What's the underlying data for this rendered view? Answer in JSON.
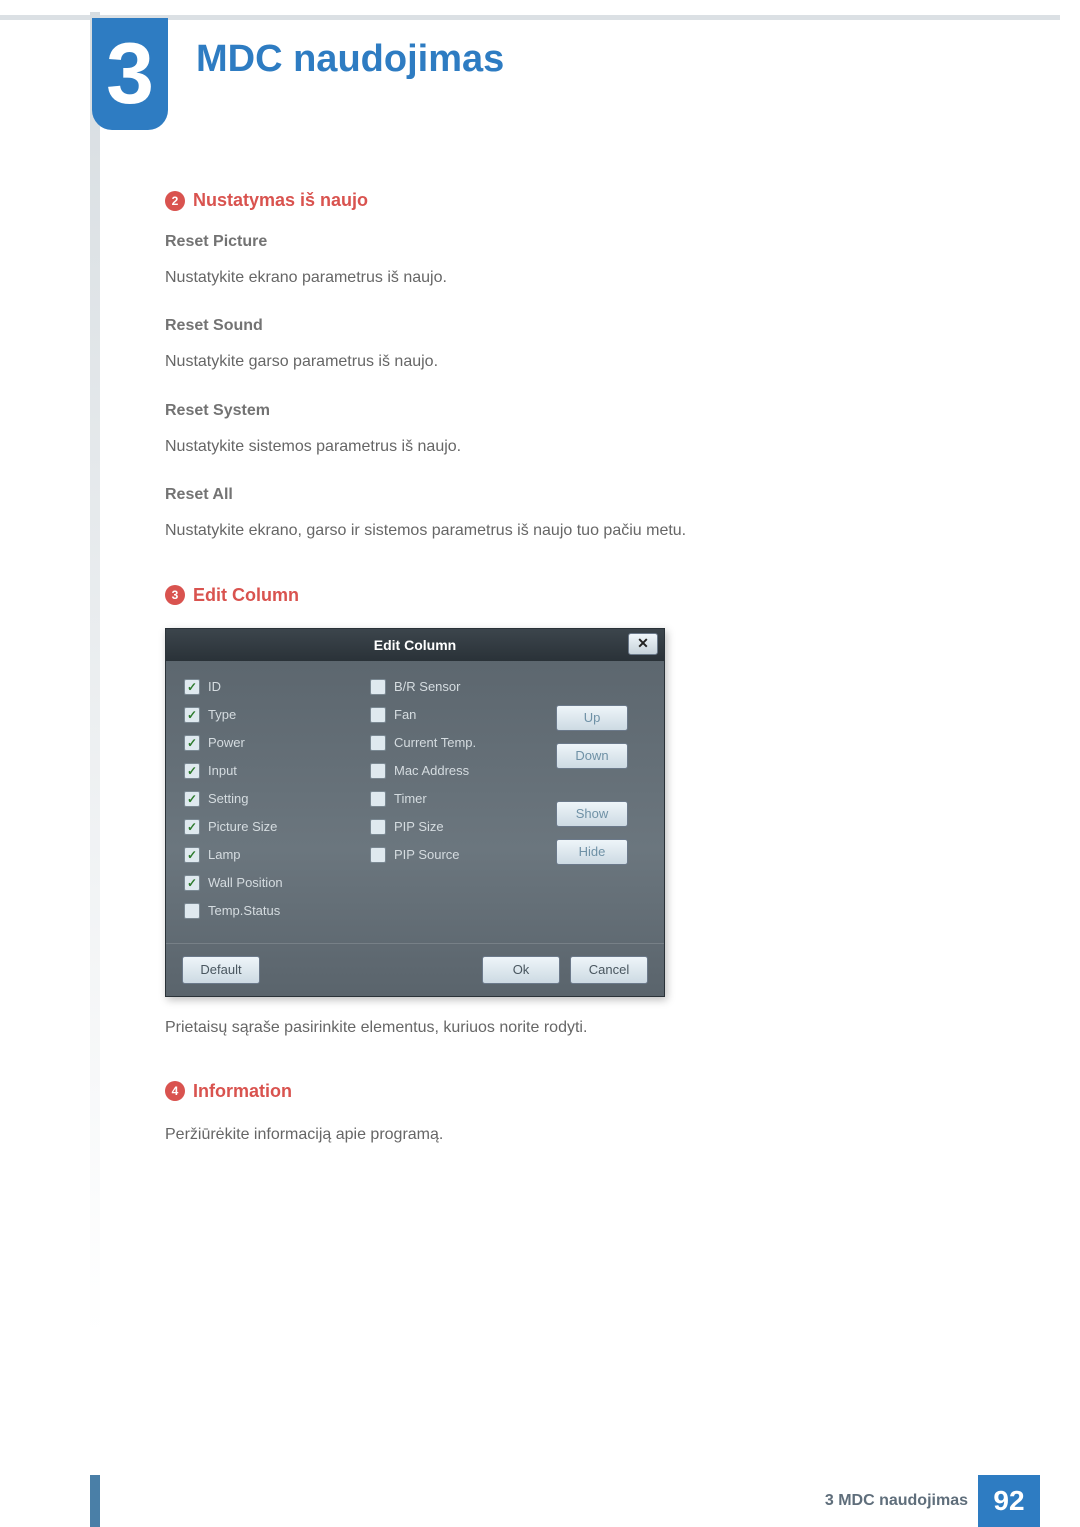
{
  "chapter": {
    "number": "3",
    "title": "MDC naudojimas"
  },
  "sections": {
    "reset": {
      "num": "2",
      "title": "Nustatymas iš naujo",
      "items": {
        "resetPicture": {
          "heading": "Reset Picture",
          "text": "Nustatykite ekrano parametrus iš naujo."
        },
        "resetSound": {
          "heading": "Reset Sound",
          "text": "Nustatykite garso parametrus iš naujo."
        },
        "resetSystem": {
          "heading": "Reset System",
          "text": "Nustatykite sistemos parametrus iš naujo."
        },
        "resetAll": {
          "heading": "Reset All",
          "text": "Nustatykite ekrano, garso ir sistemos parametrus iš naujo tuo pačiu metu."
        }
      }
    },
    "editColumn": {
      "num": "3",
      "title": "Edit Column",
      "caption": "Prietaisų sąraše pasirinkite elementus, kuriuos norite rodyti."
    },
    "information": {
      "num": "4",
      "title": "Information",
      "text": "Peržiūrėkite informaciją apie programą."
    }
  },
  "dialog": {
    "title": "Edit Column",
    "close": "✕",
    "columnsA": [
      {
        "label": "ID",
        "checked": true
      },
      {
        "label": "Type",
        "checked": true
      },
      {
        "label": "Power",
        "checked": true
      },
      {
        "label": "Input",
        "checked": true
      },
      {
        "label": "Setting",
        "checked": true
      },
      {
        "label": "Picture Size",
        "checked": true
      },
      {
        "label": "Lamp",
        "checked": true
      },
      {
        "label": "Wall Position",
        "checked": true
      },
      {
        "label": "Temp.Status",
        "checked": false
      }
    ],
    "columnsB": [
      {
        "label": "B/R Sensor",
        "checked": false
      },
      {
        "label": "Fan",
        "checked": false
      },
      {
        "label": "Current Temp.",
        "checked": false
      },
      {
        "label": "Mac Address",
        "checked": false
      },
      {
        "label": "Timer",
        "checked": false
      },
      {
        "label": "PIP Size",
        "checked": false
      },
      {
        "label": "PIP Source",
        "checked": false
      }
    ],
    "sideButtons": {
      "up": "Up",
      "down": "Down",
      "show": "Show",
      "hide": "Hide"
    },
    "footerButtons": {
      "default": "Default",
      "ok": "Ok",
      "cancel": "Cancel"
    }
  },
  "footer": {
    "label": "3 MDC naudojimas",
    "page": "92"
  }
}
